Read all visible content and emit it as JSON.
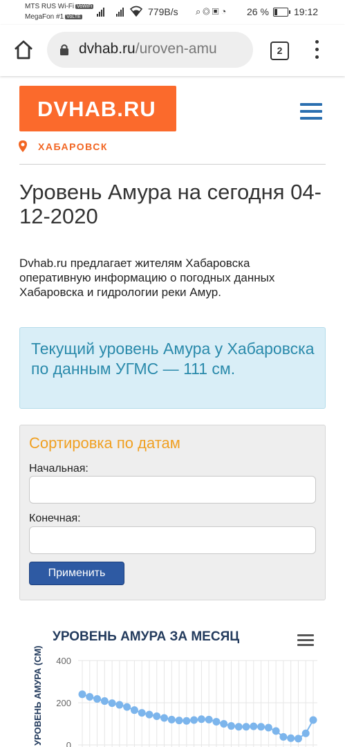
{
  "status_bar": {
    "carrier1": "MTS RUS Wi-Fi",
    "carrier1_badge": "VoWiFi",
    "carrier2": "MegaFon #1",
    "carrier2_badge": "VoLTE",
    "net_speed": "779B/s",
    "battery": "26 %",
    "battery_level": 0.26,
    "time": "19:12"
  },
  "browser": {
    "url_host": "dvhab.ru",
    "url_path": "/uroven-amu",
    "tab_count": "2"
  },
  "site": {
    "logo": "DVHAB.RU",
    "city": "ХАБАРОВСК",
    "accent": "#fb6a2c"
  },
  "page": {
    "title": "Уровень Амура на сегодня 04-12-2020",
    "intro": "Dvhab.ru предлагает жителям Хабаровска оперативную информацию о погодных данных Хабаровска и гидрологии реки Амур.",
    "current_level": "Текущий уровень Амура у Хабаровска по данным УГМС — 111 см."
  },
  "sort_form": {
    "title": "Сортировка по датам",
    "start_label": "Начальная:",
    "start_value": "",
    "end_label": "Конечная:",
    "end_value": "",
    "apply_label": "Применить"
  },
  "chart_data": {
    "type": "line",
    "title": "УРОВЕНЬ АМУРА ЗА МЕСЯЦ",
    "ylabel": "УРОВЕНЬ АМУРА (СМ)",
    "ylim": [
      0,
      400
    ],
    "yticks": [
      "400",
      "200",
      "0"
    ],
    "grid": true,
    "values": [
      240,
      228,
      218,
      208,
      198,
      190,
      180,
      165,
      152,
      144,
      136,
      128,
      120,
      116,
      114,
      118,
      122,
      120,
      110,
      100,
      90,
      86,
      86,
      88,
      86,
      82,
      66,
      38,
      32,
      30,
      55,
      118
    ],
    "color": "#7cb5ec"
  }
}
